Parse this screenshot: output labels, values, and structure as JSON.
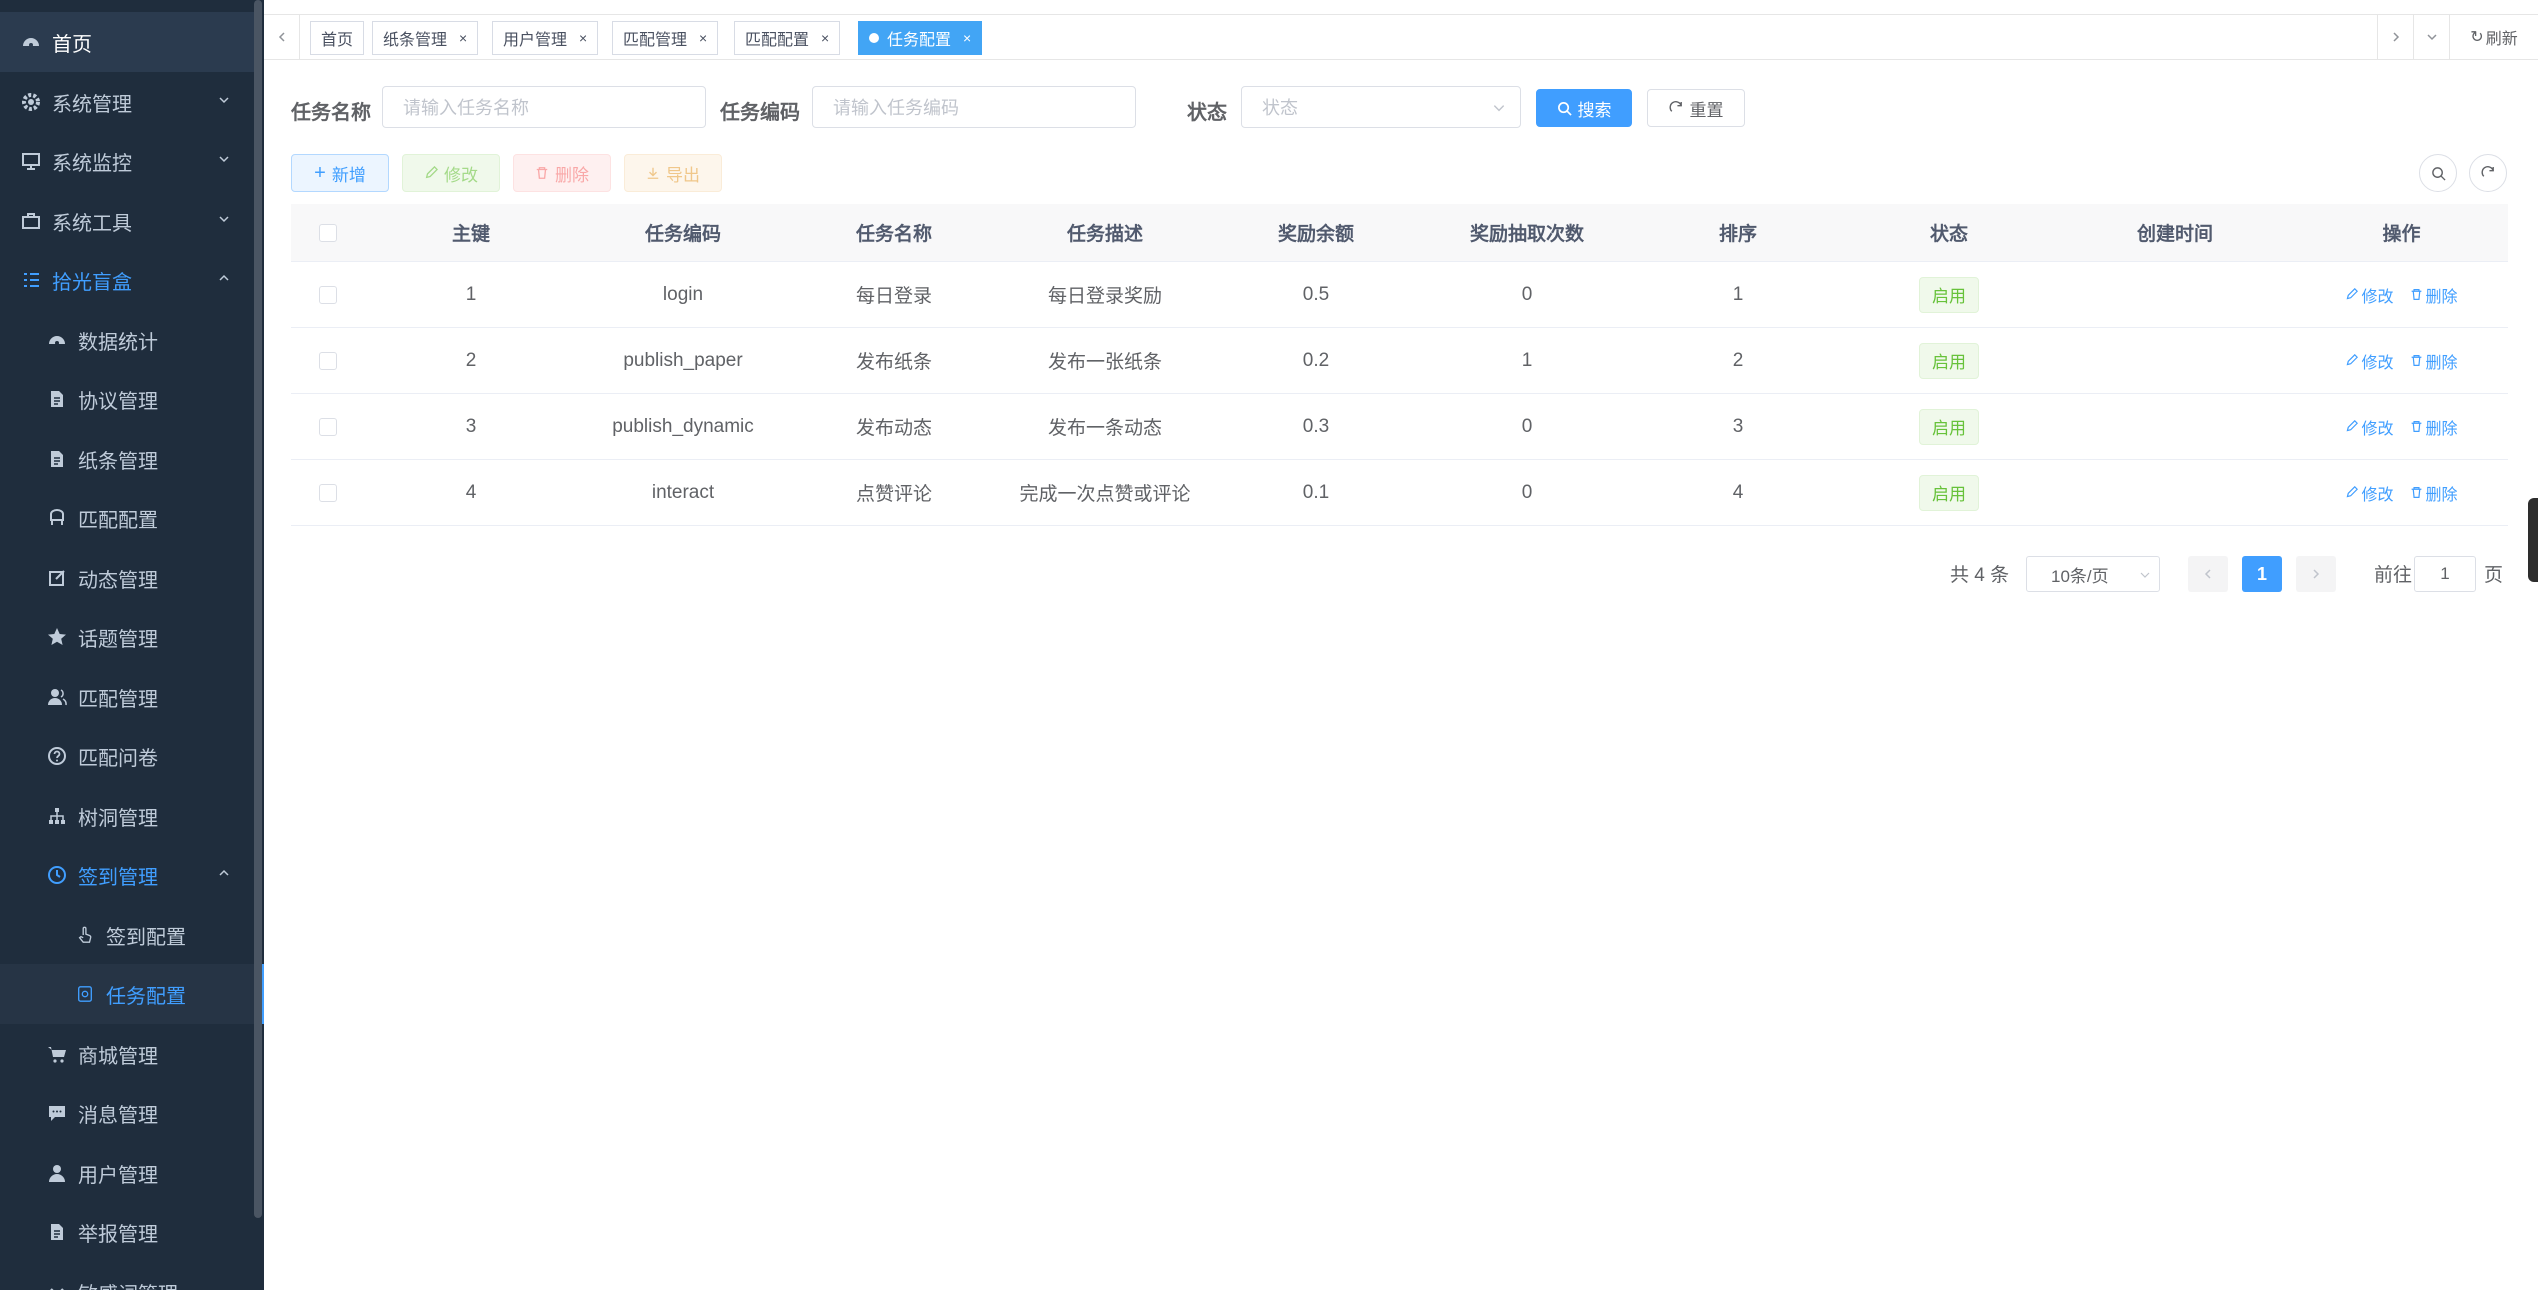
{
  "sidebar": {
    "items": [
      {
        "label": "首页",
        "icon": "dashboard-icon"
      },
      {
        "label": "系统管理",
        "icon": "gear-icon"
      },
      {
        "label": "系统监控",
        "icon": "monitor-icon"
      },
      {
        "label": "系统工具",
        "icon": "toolbox-icon"
      },
      {
        "label": "拾光盲盒",
        "icon": "tree-list-icon"
      },
      {
        "label": "数据统计",
        "icon": "dashboard-icon"
      },
      {
        "label": "协议管理",
        "icon": "document-icon"
      },
      {
        "label": "纸条管理",
        "icon": "document-icon"
      },
      {
        "label": "匹配配置",
        "icon": "chair-icon"
      },
      {
        "label": "动态管理",
        "icon": "edit-icon"
      },
      {
        "label": "话题管理",
        "icon": "star-icon"
      },
      {
        "label": "匹配管理",
        "icon": "peoples-icon"
      },
      {
        "label": "匹配问卷",
        "icon": "question-icon"
      },
      {
        "label": "树洞管理",
        "icon": "tree-icon"
      },
      {
        "label": "签到管理",
        "icon": "clock-icon"
      },
      {
        "label": "签到配置",
        "icon": "hand-icon"
      },
      {
        "label": "任务配置",
        "icon": "task-icon"
      },
      {
        "label": "商城管理",
        "icon": "cart-icon"
      },
      {
        "label": "消息管理",
        "icon": "message-icon"
      },
      {
        "label": "用户管理",
        "icon": "user-icon"
      },
      {
        "label": "举报管理",
        "icon": "document-icon"
      },
      {
        "label": "敏感词管理",
        "icon": "chevron-down-icon"
      }
    ]
  },
  "tags": {
    "items": [
      "首页",
      "纸条管理",
      "用户管理",
      "匹配管理",
      "匹配配置",
      "任务配置"
    ],
    "refresh": "刷新"
  },
  "search": {
    "name_label": "任务名称",
    "name_placeholder": "请输入任务名称",
    "code_label": "任务编码",
    "code_placeholder": "请输入任务编码",
    "status_label": "状态",
    "status_placeholder": "状态",
    "search_btn": "搜索",
    "reset_btn": "重置"
  },
  "toolbar": {
    "add": "新增",
    "edit": "修改",
    "delete": "删除",
    "export": "导出"
  },
  "table": {
    "columns": [
      "主键",
      "任务编码",
      "任务名称",
      "任务描述",
      "奖励余额",
      "奖励抽取次数",
      "排序",
      "状态",
      "创建时间",
      "操作"
    ],
    "rows": [
      {
        "id": "1",
        "code": "login",
        "name": "每日登录",
        "desc": "每日登录奖励",
        "reward": "0.5",
        "draws": "0",
        "sort": "1",
        "status": "启用",
        "created": ""
      },
      {
        "id": "2",
        "code": "publish_paper",
        "name": "发布纸条",
        "desc": "发布一张纸条",
        "reward": "0.2",
        "draws": "1",
        "sort": "2",
        "status": "启用",
        "created": ""
      },
      {
        "id": "3",
        "code": "publish_dynamic",
        "name": "发布动态",
        "desc": "发布一条动态",
        "reward": "0.3",
        "draws": "0",
        "sort": "3",
        "status": "启用",
        "created": ""
      },
      {
        "id": "4",
        "code": "interact",
        "name": "点赞评论",
        "desc": "完成一次点赞或评论",
        "reward": "0.1",
        "draws": "0",
        "sort": "4",
        "status": "启用",
        "created": ""
      }
    ],
    "op_edit": "修改",
    "op_delete": "删除"
  },
  "pagination": {
    "total": "共 4 条",
    "page_size": "10条/页",
    "current": "1",
    "goto_label": "前往",
    "goto_value": "1",
    "page_suffix": "页"
  },
  "colors": {
    "primary": "#409eff",
    "sidebar_bg": "#1f2d3d",
    "success": "#67c23a"
  }
}
